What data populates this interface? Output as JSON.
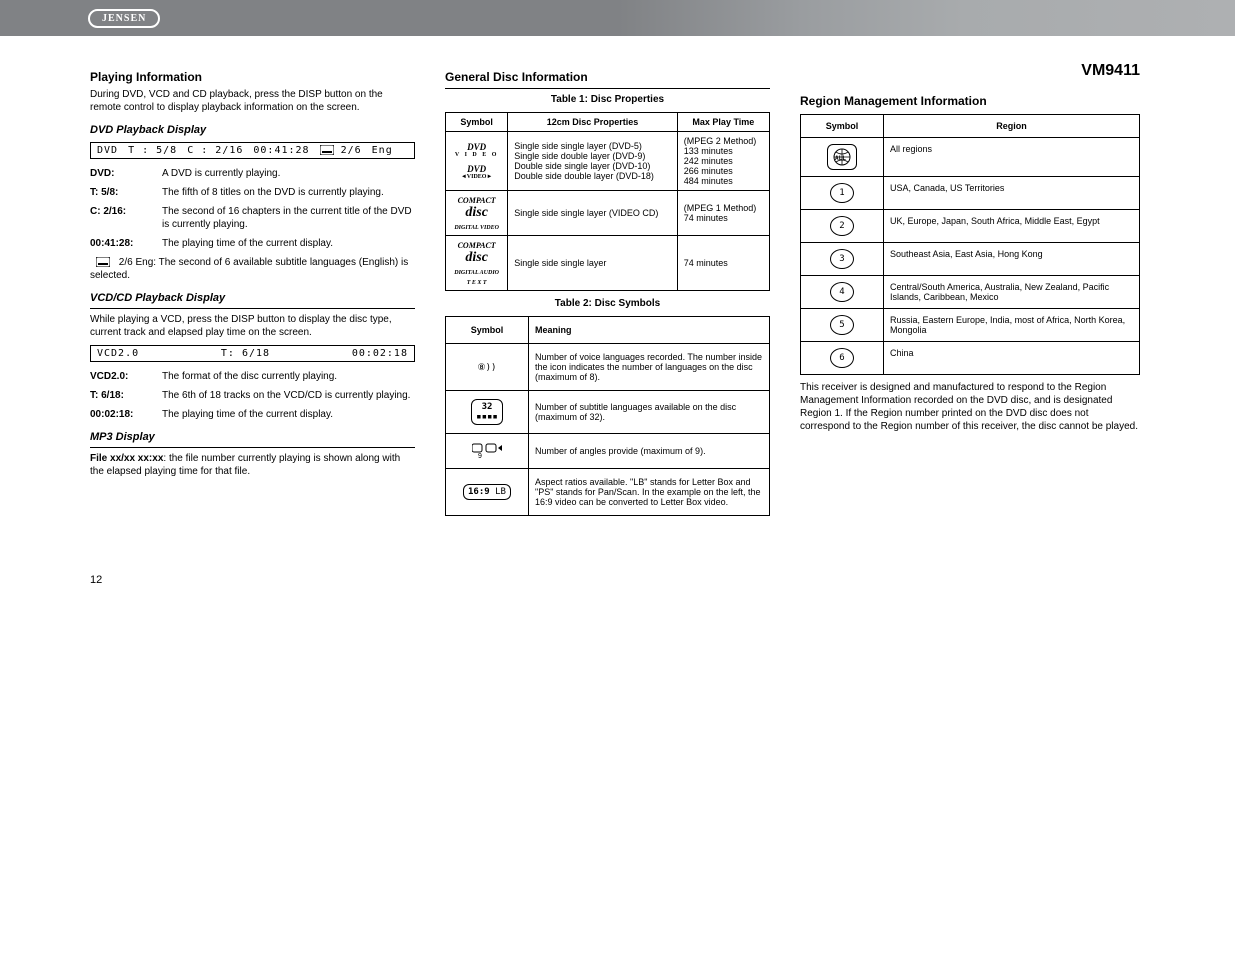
{
  "brand": "JENSEN",
  "product": "VM9411",
  "page_number": "12",
  "col1": {
    "h_playinfo": "Playing Information",
    "p_playinfo": "During DVD, VCD and CD playback, press the DISP button on the remote control to display playback information on the screen.",
    "h_dvdplay": "DVD Playback Display",
    "dvd_status": {
      "type": "DVD",
      "title": "T : 5/8",
      "chapter": "C : 2/16",
      "time": "00:41:28",
      "sub": "2/6",
      "lang": "Eng"
    },
    "dvd_fields": [
      {
        "lab": "DVD:",
        "val": "A DVD is currently playing."
      },
      {
        "lab": "T: 5/8:",
        "val": "The fifth of 8 titles on the DVD is currently playing."
      },
      {
        "lab": "C: 2/16:",
        "val": "The second of 16 chapters in the current title of the DVD is currently playing."
      },
      {
        "lab": "00:41:28:",
        "val": "The playing time of the current display."
      }
    ],
    "dvd_sublang": "2/6 Eng: The second of 6 available subtitle languages (English) is selected.",
    "h_vcdcd": "VCD/CD Playback Display",
    "vcd_para": "While playing a VCD, press the DISP button to display the disc type, current track and elapsed play time on the screen.",
    "vcd_status": {
      "type": "VCD2.0",
      "track": "T: 6/18",
      "time": "00:02:18"
    },
    "vcd_fields": [
      {
        "lab": "VCD2.0:",
        "val": "The format of the disc currently playing."
      },
      {
        "lab": "T: 6/18:",
        "val": "The 6th of 18 tracks on the VCD/CD is currently playing."
      },
      {
        "lab": "00:02:18:",
        "val": "The playing time of the current display."
      }
    ],
    "h_mp3": "MP3 Display",
    "mp3_line_prefix": "File xx/xx xx:xx",
    "mp3_line_rest": ": the file number currently playing is shown along with the elapsed playing time for that file."
  },
  "col2": {
    "h_gen": "General Disc Information",
    "t1_h": "Table 1: Disc Properties",
    "t1_head": [
      "Symbol",
      "12cm Disc Properties",
      "Max Play Time"
    ],
    "t1_rows": [
      {
        "logo": "DVD-V-DS",
        "prop": "Single side single layer (DVD-5)\nSingle side double layer (DVD-9)\nDouble side single layer (DVD-10)\nDouble side double layer (DVD-18)",
        "time": "(MPEG 2 Method)\n133 minutes\n242 minutes\n266 minutes\n484 minutes"
      },
      {
        "logo": "VCD",
        "prop": "Single side single layer (VIDEO CD)",
        "time": "(MPEG 1 Method)\n74 minutes"
      },
      {
        "logo": "CDDA",
        "prop": "Single side single layer",
        "time": "74 minutes"
      }
    ],
    "t2_h": "Table 2: Disc Symbols",
    "t2_head": [
      "Symbol",
      "Meaning"
    ],
    "t2_rows": [
      {
        "mark": "8))",
        "meaning": "Number of voice languages recorded. The number inside the icon indicates the number of languages on the disc (maximum of 8)."
      },
      {
        "mark": "32",
        "meaning": "Number of subtitle languages available on the disc (maximum of 32)."
      },
      {
        "mark": "9cams",
        "meaning": "Number of angles provide (maximum of 9)."
      },
      {
        "mark": "16:9LB",
        "meaning": "Aspect ratios available. \"LB\" stands for Letter Box and \"PS\" stands for Pan/Scan. In the example on the left, the 16:9 video can be converted to Letter Box video."
      }
    ]
  },
  "col3": {
    "h_reg": "Region Management Information",
    "p_reg": "This receiver is designed and manufactured to respond to the Region Management Information recorded on the DVD disc, and is designated Region 1. If the Region number printed on the DVD disc does not correspond to the Region number of this receiver, the disc cannot be played.",
    "reg_head": [
      "Symbol",
      "Region"
    ],
    "reg_rows": [
      {
        "sym": "ALL",
        "region": "All regions"
      },
      {
        "sym": "1",
        "region": "USA, Canada, US Territories"
      },
      {
        "sym": "2",
        "region": "UK, Europe, Japan, South Africa, Middle East, Egypt"
      },
      {
        "sym": "3",
        "region": "Southeast Asia, East Asia, Hong Kong"
      },
      {
        "sym": "4",
        "region": "Central/South America, Australia, New Zealand, Pacific Islands, Caribbean, Mexico"
      },
      {
        "sym": "5",
        "region": "Russia, Eastern Europe, India, most of Africa, North Korea, Mongolia"
      },
      {
        "sym": "6",
        "region": "China"
      }
    ]
  },
  "chart_data": {
    "type": "table",
    "title": "Disc Properties",
    "columns": [
      "Symbol",
      "12cm Disc Properties",
      "Max Play Time"
    ],
    "rows": [
      [
        "DVD Video",
        "DVD-5 / DVD-9 / DVD-10 / DVD-18",
        "133 / 242 / 266 / 484 minutes"
      ],
      [
        "Video CD",
        "Single side single layer (VIDEO CD)",
        "74 minutes"
      ],
      [
        "CD Digital Audio",
        "Single side single layer",
        "74 minutes"
      ]
    ]
  }
}
